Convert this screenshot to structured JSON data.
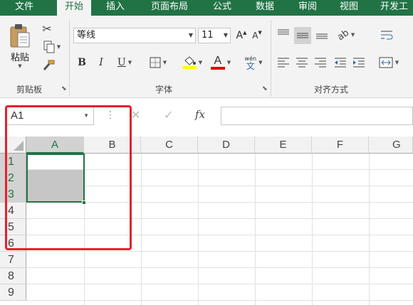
{
  "menu": {
    "tabs": [
      "文件",
      "开始",
      "插入",
      "页面布局",
      "公式",
      "数据",
      "审阅",
      "视图",
      "开发工"
    ],
    "active_index": 1
  },
  "clipboard": {
    "paste_label": "粘贴",
    "group_label": "剪贴板"
  },
  "font": {
    "font_name": "等线",
    "font_size": "11",
    "bold": "B",
    "italic": "I",
    "underline": "U",
    "grow_label": "A",
    "font_color_label": "A",
    "phonetic_top": "wén",
    "phonetic_bottom": "文",
    "group_label": "字体"
  },
  "alignment": {
    "group_label": "对齐方式"
  },
  "formula_bar": {
    "name_box": "A1",
    "cancel_symbol": "✕",
    "enter_symbol": "✓",
    "fx_label": "fx",
    "content": ""
  },
  "sheet": {
    "columns": [
      "A",
      "B",
      "C",
      "D",
      "E",
      "F",
      "G"
    ],
    "rows": [
      "1",
      "2",
      "3",
      "4",
      "5",
      "6",
      "7",
      "8",
      "9"
    ],
    "active_cell": "A1",
    "selected_range": "A1:A3"
  },
  "colors": {
    "excel_green": "#217346",
    "highlight_red": "#e8202a",
    "font_color_bar": "#e00000",
    "fill_color_bar": "#ffff00"
  }
}
